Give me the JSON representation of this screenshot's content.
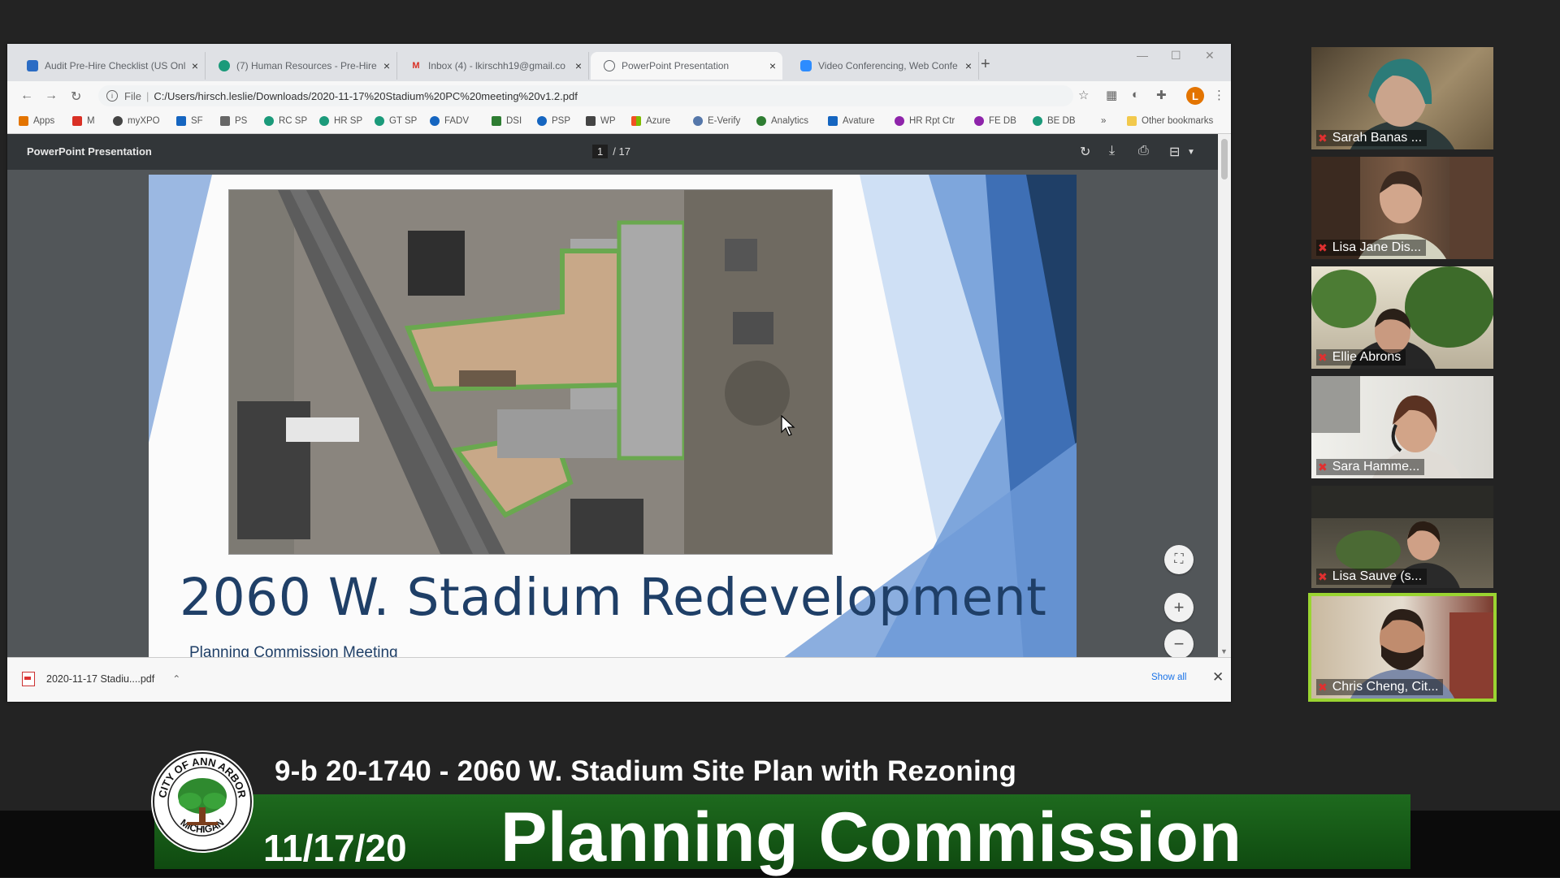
{
  "browser": {
    "tabs": [
      {
        "label": "Audit Pre-Hire Checklist (US Onl",
        "icon_color": "#2b6cc4"
      },
      {
        "label": "(7) Human Resources - Pre-Hire",
        "icon_color": "#1b9a7a"
      },
      {
        "label": "Inbox (4) - lkirschh19@gmail.co",
        "icon_color": "#d93025"
      },
      {
        "label": "PowerPoint Presentation",
        "icon_color": "#5f6368"
      },
      {
        "label": "Video Conferencing, Web Confe",
        "icon_color": "#2d8cff"
      }
    ],
    "active_tab": 3,
    "address": {
      "scheme": "File",
      "url": "C:/Users/hirsch.leslie/Downloads/2020-11-17%20Stadium%20PC%20meeting%20v1.2.pdf"
    },
    "avatar_letter": "L",
    "bookmarks": [
      {
        "label": "Apps",
        "color": "#e37400"
      },
      {
        "label": "M",
        "color": "#d93025"
      },
      {
        "label": "myXPO",
        "color": "#444444"
      },
      {
        "label": "SF",
        "color": "#1565c0"
      },
      {
        "label": "PS",
        "color": "#666666"
      },
      {
        "label": "RC SP",
        "color": "#1b9a7a"
      },
      {
        "label": "HR SP",
        "color": "#1b9a7a"
      },
      {
        "label": "GT SP",
        "color": "#1b9a7a"
      },
      {
        "label": "FADV",
        "color": "#1565c0"
      },
      {
        "label": "DSI",
        "color": "#2e7d32"
      },
      {
        "label": "PSP",
        "color": "#1565c0"
      },
      {
        "label": "WP",
        "color": "#444444"
      },
      {
        "label": "Azure",
        "color": "#f25022"
      },
      {
        "label": "E-Verify",
        "color": "#5577aa"
      },
      {
        "label": "Analytics",
        "color": "#2e7d32"
      },
      {
        "label": "Avature",
        "color": "#1565c0"
      },
      {
        "label": "HR Rpt Ctr",
        "color": "#8e24aa"
      },
      {
        "label": "FE DB",
        "color": "#8e24aa"
      },
      {
        "label": "BE DB",
        "color": "#1b9a7a"
      }
    ],
    "other_bookmarks": "Other bookmarks",
    "more_glyph": "»"
  },
  "pdf": {
    "title": "PowerPoint Presentation",
    "current_page": "1",
    "total_pages": "/ 17"
  },
  "slide": {
    "title": "2060 W. Stadium Redevelopment",
    "subtitle": "Planning Commission Meeting"
  },
  "download": {
    "filename": "2020-11-17 Stadiu....pdf",
    "show_all": "Show all"
  },
  "participants": [
    {
      "name": "Sarah Banas ..."
    },
    {
      "name": "Lisa Jane Dis..."
    },
    {
      "name": "Ellie Abrons"
    },
    {
      "name": "Sara Hamme..."
    },
    {
      "name": "Lisa Sauve (s..."
    },
    {
      "name": "Chris Cheng, Cit..."
    }
  ],
  "active_speaker": 5,
  "broadcast": {
    "agenda_item": "9-b 20-1740 - 2060 W. Stadium Site Plan with Rezoning",
    "date": "11/17/20",
    "title": "Planning Commission",
    "seal_top_text": "CITY OF ANN ARBOR",
    "seal_bottom_text": "MICHIGAN"
  }
}
